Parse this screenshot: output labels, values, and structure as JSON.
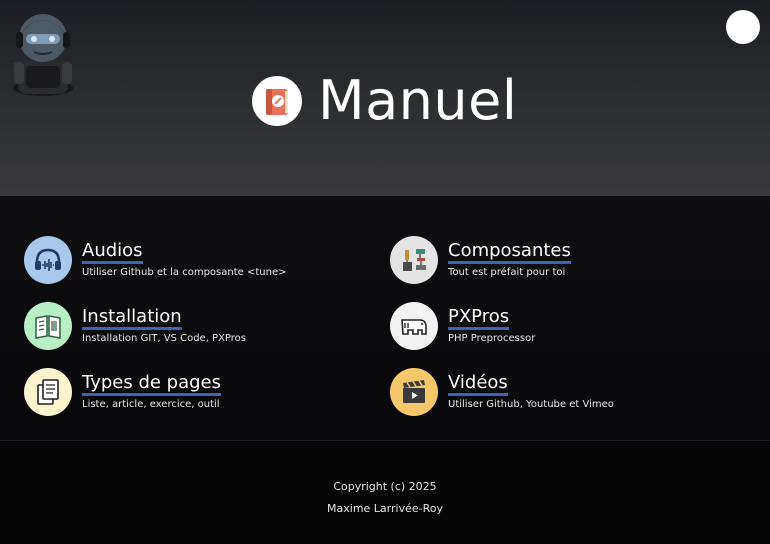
{
  "header": {
    "title": "Manuel",
    "avatar_icon": "robot-avatar-icon",
    "title_icon": "book-icon",
    "toggle_icon": "theme-toggle-icon"
  },
  "cards": [
    {
      "label": "Audios",
      "description": "Utiliser Github et la composante <tune>",
      "icon": "headphones-waveform-icon",
      "color": "#a8c8ec"
    },
    {
      "label": "Composantes",
      "description": "Tout est préfait pour toi",
      "icon": "circuit-components-icon",
      "color": "#e4e4e4"
    },
    {
      "label": "Installation",
      "description": "Installation GIT, VS Code, PXPros",
      "icon": "manual-book-icon",
      "color": "#b9efc4"
    },
    {
      "label": "PXPros",
      "description": "PHP Preprocessor",
      "icon": "php-elephant-icon",
      "color": "#f2f2f2"
    },
    {
      "label": "Types de pages",
      "description": "Liste, article, exercice, outil",
      "icon": "documents-icon",
      "color": "#fbf4cf"
    },
    {
      "label": "Vidéos",
      "description": "Utiliser Github, Youtube et Vimeo",
      "icon": "clapperboard-icon",
      "color": "#f6c86a"
    }
  ],
  "footer": {
    "copyright": "Copyright (c) 2025",
    "author": "Maxime Larrivée-Roy"
  },
  "colors": {
    "link_underline": "#3f63b8",
    "header_bg": "#2e2f33",
    "body_bg": "#070708"
  }
}
